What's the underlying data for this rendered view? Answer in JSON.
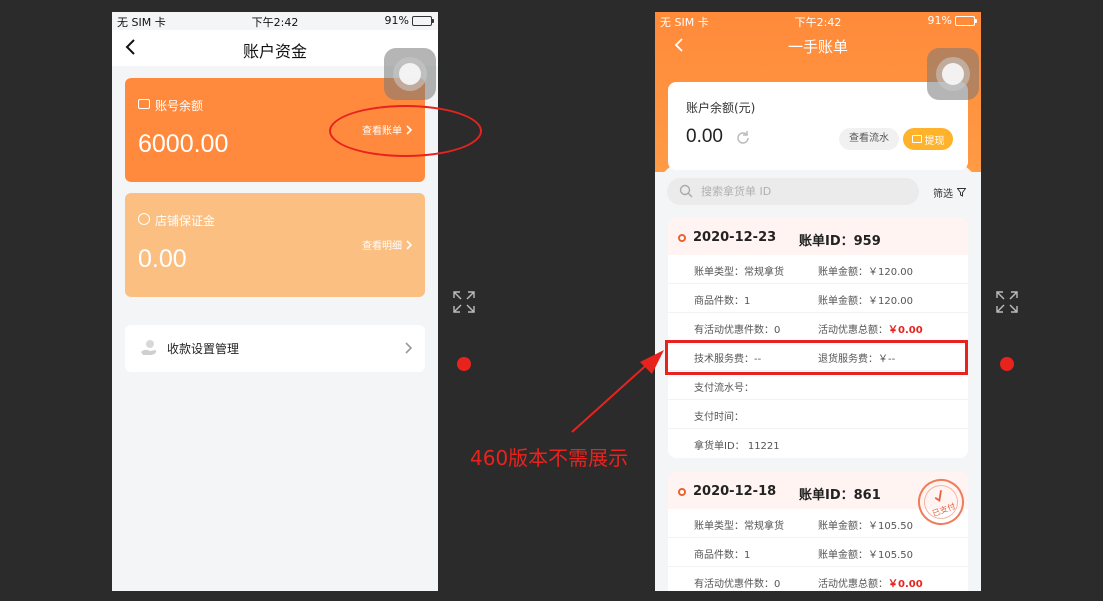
{
  "screen1": {
    "status": {
      "carrier": "无 SIM 卡",
      "time": "下午2:42",
      "battery": "91%"
    },
    "nav_title": "账户资金",
    "account_balance": {
      "label": "账号余额",
      "amount": "6000.00",
      "link": "查看账单"
    },
    "deposit": {
      "label": "店铺保证金",
      "amount": "0.00",
      "link": "查看明细"
    },
    "payment_settings": {
      "label": "收款设置管理"
    }
  },
  "screen2": {
    "status": {
      "carrier": "无 SIM 卡",
      "time": "下午2:42",
      "battery": "91%"
    },
    "nav_title": "一手账单",
    "balance": {
      "label": "账户余额(元)",
      "amount": "0.00",
      "flow_button": "查看流水",
      "withdraw_button": "提现"
    },
    "search": {
      "placeholder": "搜索拿货单 ID"
    },
    "filter_label": "筛选",
    "bills": [
      {
        "date": "2020-12-23",
        "bill_id": "账单ID：959",
        "rows": [
          [
            "账单类型：常规拿货",
            "账单金额：￥120.00"
          ],
          [
            "商品件数：1",
            "账单金额：￥120.00"
          ],
          [
            "有活动优惠件数：0",
            "活动优惠总额：",
            "￥0.00"
          ],
          [
            "技术服务费：--",
            "退货服务费：￥--"
          ],
          [
            "支付流水号：",
            ""
          ],
          [
            "支付时间：",
            ""
          ],
          [
            "拿货单ID：  11221",
            ""
          ]
        ]
      },
      {
        "date": "2020-12-18",
        "bill_id": "账单ID：861",
        "stamp": "已支付",
        "rows": [
          [
            "账单类型：常规拿货",
            "账单金额：￥105.50"
          ],
          [
            "商品件数：1",
            "账单金额：￥105.50"
          ],
          [
            "有活动优惠件数：0",
            "活动优惠总额：",
            "￥0.00"
          ]
        ]
      }
    ]
  },
  "annotation": {
    "text": "460版本不需展示",
    "color": "#e8231e"
  },
  "colors": {
    "orange": "#ff8a3d",
    "peach": "#fbbf82",
    "accent_yellow": "#ffb22c",
    "annotation_red": "#e8231e"
  }
}
